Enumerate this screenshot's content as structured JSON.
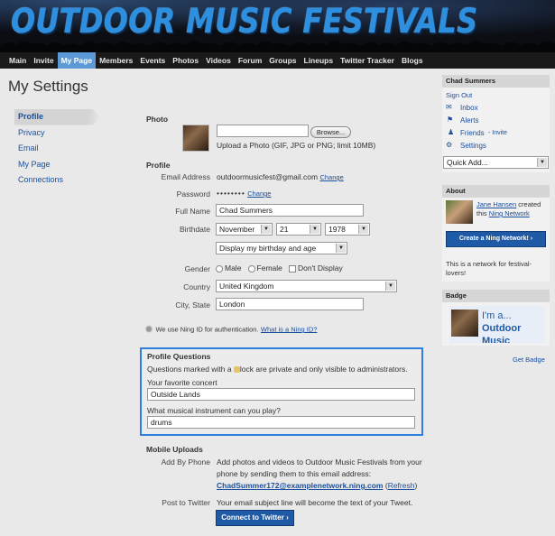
{
  "banner": {
    "title": "OUTDOOR MUSIC FESTIVALS"
  },
  "nav": {
    "items": [
      {
        "label": "Main"
      },
      {
        "label": "Invite"
      },
      {
        "label": "My Page"
      },
      {
        "label": "Members"
      },
      {
        "label": "Events"
      },
      {
        "label": "Photos"
      },
      {
        "label": "Videos"
      },
      {
        "label": "Forum"
      },
      {
        "label": "Groups"
      },
      {
        "label": "Lineups"
      },
      {
        "label": "Twitter Tracker"
      },
      {
        "label": "Blogs"
      }
    ],
    "active": "My Page"
  },
  "page": {
    "title": "My Settings"
  },
  "side_nav": {
    "items": [
      {
        "label": "Profile"
      },
      {
        "label": "Privacy"
      },
      {
        "label": "Email"
      },
      {
        "label": "My Page"
      },
      {
        "label": "Connections"
      }
    ]
  },
  "photo": {
    "label": "Photo",
    "browse": "Browse...",
    "hint": "Upload a Photo (GIF, JPG or PNG; limit 10MB)"
  },
  "profile": {
    "label": "Profile",
    "email_label": "Email Address",
    "email_value": "outdoormusicfest@gmail.com",
    "change": "Change",
    "password_label": "Password",
    "password_value": "••••••••",
    "fullname_label": "Full Name",
    "fullname_value": "Chad Summers",
    "birthdate_label": "Birthdate",
    "birth_month": "November",
    "birth_day": "21",
    "birth_year": "1978",
    "birth_display": "Display my birthday and age",
    "gender_label": "Gender",
    "gender_male": "Male",
    "gender_female": "Female",
    "gender_none": "Don't Display",
    "country_label": "Country",
    "country_value": "United Kingdom",
    "city_label": "City, State",
    "city_value": "London",
    "ning_text": "We use Ning ID for authentication.",
    "ning_link": "What is a Ning ID?"
  },
  "questions": {
    "label": "Profile Questions",
    "note_pre": "Questions marked with a",
    "note_post": "lock are private and only visible to administrators.",
    "q1_label": "Your favorite concert",
    "q1_value": "Outside Lands",
    "q2_label": "What musical instrument can you play?",
    "q2_value": "drums"
  },
  "mobile": {
    "label": "Mobile Uploads",
    "add_label": "Add By Phone",
    "add_text_1": "Add photos and videos to Outdoor Music Festivals from your",
    "add_text_2": "phone by sending them to this email address:",
    "add_email": "ChadSummer172@examplenetwork.ning.com",
    "refresh": "Refresh",
    "twitter_label": "Post to Twitter",
    "twitter_text": "Your email subject line will become the text of your Tweet.",
    "twitter_button": "Connect to Twitter ›"
  },
  "user_box": {
    "name": "Chad Summers",
    "sign_out": "Sign Out",
    "inbox": "Inbox",
    "alerts": "Alerts",
    "friends": "Friends",
    "invite": "- Invite",
    "settings": "Settings",
    "quick_add": "Quick Add..."
  },
  "about": {
    "label": "About",
    "creator": "Jane Hansen",
    "created": "created",
    "this": "this",
    "network": "Ning Network",
    "button": "Create a Ning Network! ›",
    "desc": "This is a network for festival-lovers!"
  },
  "badge": {
    "label": "Badge",
    "line1": "I'm a...",
    "line2": "Outdoor",
    "line3": "Music",
    "get": "Get Badge"
  }
}
